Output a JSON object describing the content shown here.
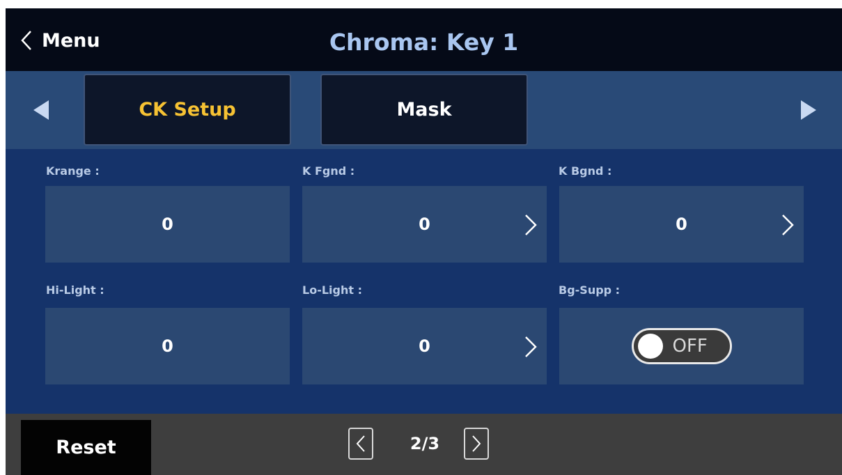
{
  "header": {
    "back_label": "Menu",
    "title": "Chroma: Key 1"
  },
  "tabs": [
    {
      "label": "CK Setup",
      "active": true
    },
    {
      "label": "Mask",
      "active": false
    }
  ],
  "params": {
    "krange": {
      "label": "Krange :",
      "value": "0"
    },
    "k_fgnd": {
      "label": "K Fgnd :",
      "value": "0"
    },
    "k_bgnd": {
      "label": "K Bgnd :",
      "value": "0"
    },
    "hi_light": {
      "label": "Hi-Light :",
      "value": "0"
    },
    "lo_light": {
      "label": "Lo-Light :",
      "value": "0"
    },
    "bg_supp": {
      "label": "Bg-Supp :",
      "value": "OFF"
    }
  },
  "footer": {
    "reset_label": "Reset",
    "page_indicator": "2/3"
  },
  "icons": [
    "chevron-left-icon",
    "triangle-left-icon",
    "triangle-right-icon",
    "chevron-right-icon"
  ],
  "colors": {
    "active_tab_text": "#f6c233",
    "title_text": "#a9c6f0",
    "panel_bg": "#15336a"
  }
}
